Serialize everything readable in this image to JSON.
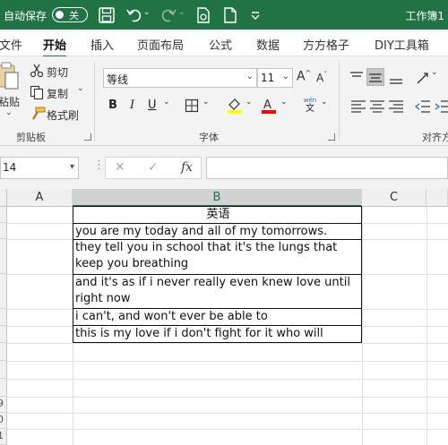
{
  "titlebar": {
    "autosave_label": "自动保存",
    "autosave_state": "关",
    "document_title": "工作簿1"
  },
  "tabs": [
    "文件",
    "开始",
    "插入",
    "页面布局",
    "公式",
    "数据",
    "方方格子",
    "DIY工具箱"
  ],
  "active_tab": "开始",
  "ribbon": {
    "clipboard": {
      "paste_label": "粘贴",
      "cut_label": "剪切",
      "copy_label": "复制",
      "format_painter_label": "格式刷",
      "group_label": "剪贴板"
    },
    "font": {
      "font_name": "等线",
      "font_size": "11",
      "bold": "B",
      "italic": "I",
      "underline": "U",
      "grow_font": "A",
      "shrink_font": "A",
      "phonetic_top": "wén",
      "phonetic_bottom": "文",
      "group_label": "字体",
      "fill_color": "#ffff00",
      "font_color": "#ff0000"
    },
    "alignment": {
      "group_label": "对齐方"
    }
  },
  "formula_bar": {
    "name_box": "14",
    "cancel_symbol": "✕",
    "enter_symbol": "✓",
    "function_symbol": "fx",
    "formula": ""
  },
  "sheet": {
    "columns": [
      "A",
      "B",
      "C"
    ],
    "selected_column": "B",
    "row_numbers_visible": [
      "9",
      "0",
      "1",
      "2"
    ],
    "cells": [
      "英语",
      "you are my today and all of my tomorrows.",
      "they tell you in school that it's the lungs that keep you breathing",
      "and it's as if i never really even knew love until right now",
      "i can't, and won't ever be able to",
      "this is my love if i don't fight for it who will"
    ]
  },
  "colors": {
    "brand_green": "#217346",
    "ribbon_bg": "#f3f3f3"
  }
}
